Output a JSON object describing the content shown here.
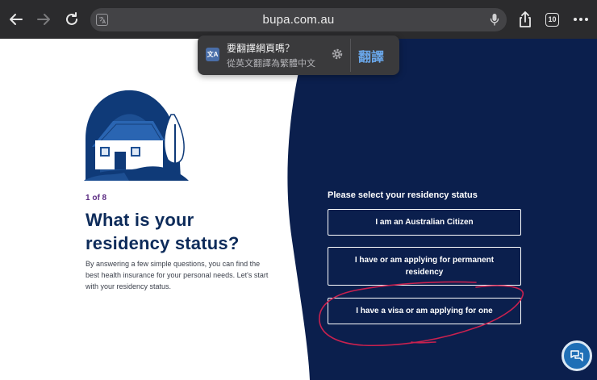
{
  "browser": {
    "url": "bupa.com.au",
    "tab_count": "10"
  },
  "translate_popup": {
    "icon_label": "文A",
    "title": "要翻譯網頁嗎？",
    "subtitle": "從英文翻譯為繁體中文",
    "translate_label": "翻譯"
  },
  "page": {
    "step": "1 of 8",
    "heading": "What is your residency status?",
    "description": "By answering a few simple questions, you can find the best health insurance for your personal needs. Let's start with your residency status.",
    "question": "Please select your residency status",
    "options": [
      "I am an Australian Citizen",
      "I have or am applying for permanent residency",
      "I have a visa or am applying for one"
    ]
  },
  "colors": {
    "navy": "#0b1f4d",
    "heading": "#0d2b5a",
    "step": "#5b2b82",
    "annotation": "#c8214f",
    "chat": "#1f6fb6"
  },
  "icons": [
    "back-arrow-icon",
    "forward-arrow-icon",
    "reload-icon",
    "translate-icon",
    "microphone-icon",
    "share-icon",
    "tabs-icon",
    "more-icon",
    "gear-icon",
    "chat-icon"
  ]
}
